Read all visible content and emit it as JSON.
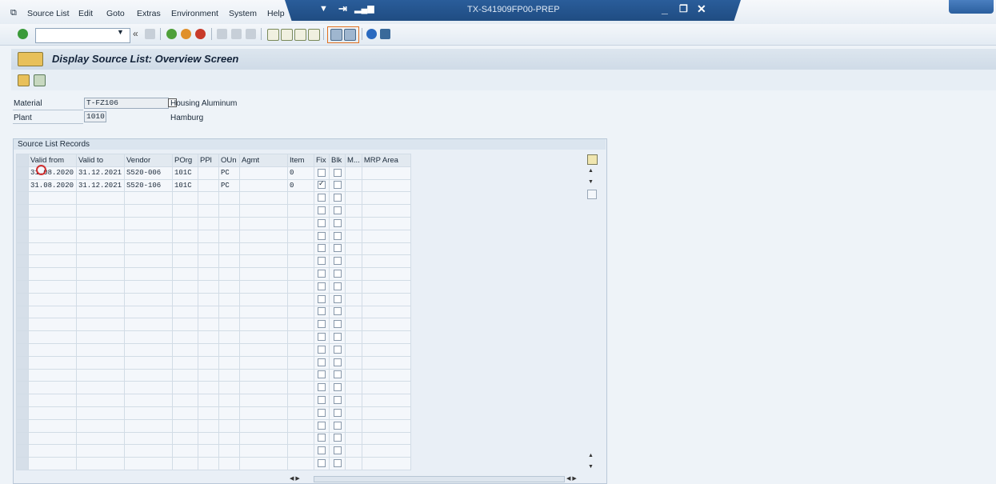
{
  "menu": {
    "items": [
      "Source List",
      "Edit",
      "Goto",
      "Extras",
      "Environment",
      "System",
      "Help"
    ]
  },
  "window": {
    "system_title": "TX-S41909FP00-PREP"
  },
  "toolbar": {
    "command_value": "",
    "icons": [
      "enter-icon",
      "back-icon",
      "save-icon",
      "exit-icon",
      "cancel-icon",
      "print-icon",
      "find-icon",
      "find-next-icon",
      "first-page-icon",
      "prev-page-icon",
      "next-page-icon",
      "last-page-icon",
      "new-session-icon",
      "shortcut-icon",
      "help-icon",
      "customize-icon"
    ]
  },
  "screen": {
    "title": "Display Source List: Overview Screen"
  },
  "header": {
    "material_label": "Material",
    "material_value": "T-FZ106",
    "material_desc": "Housing Aluminum",
    "plant_label": "Plant",
    "plant_value": "1010",
    "plant_desc": "Hamburg"
  },
  "grid": {
    "group_title": "Source List Records",
    "columns": [
      "Valid from",
      "Valid to",
      "Vendor",
      "POrg",
      "PPl",
      "OUn",
      "Agmt",
      "Item",
      "Fix",
      "Blk",
      "M...",
      "MRP Area"
    ],
    "rows": [
      {
        "valid_from": "31.08.2020",
        "valid_to": "31.12.2021",
        "vendor": "S520-006",
        "porg": "101C",
        "ppl": "",
        "oun": "PC",
        "agmt": "",
        "item": "0",
        "fix": false,
        "blk": false
      },
      {
        "valid_from": "31.08.2020",
        "valid_to": "31.12.2021",
        "vendor": "S520-106",
        "porg": "101C",
        "ppl": "",
        "oun": "PC",
        "agmt": "",
        "item": "0",
        "fix": true,
        "blk": false
      }
    ],
    "empty_rows": 22
  }
}
